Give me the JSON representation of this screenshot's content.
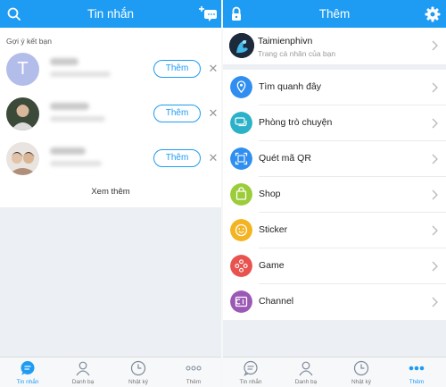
{
  "colors": {
    "accent": "#1e9cf3",
    "avatar_letter_bg": "#b3bde9"
  },
  "left": {
    "header": {
      "title": "Tin nhắn"
    },
    "suggestions": {
      "title": "Gợi ý kết bạn",
      "add_label": "Thêm",
      "see_more": "Xem thêm",
      "contacts": [
        {
          "avatar_letter": "T"
        },
        {
          "avatar_letter": ""
        },
        {
          "avatar_letter": ""
        }
      ]
    },
    "tabs": [
      {
        "label": "Tin nhắn",
        "icon": "chat-bubble-icon",
        "active": true
      },
      {
        "label": "Danh bạ",
        "icon": "contacts-icon",
        "active": false
      },
      {
        "label": "Nhật ký",
        "icon": "clock-icon",
        "active": false
      },
      {
        "label": "Thêm",
        "icon": "more-dots-icon",
        "active": false
      }
    ]
  },
  "right": {
    "header": {
      "title": "Thêm"
    },
    "profile": {
      "name": "Taimienphivn",
      "subtitle": "Trang cá nhân của bạn"
    },
    "menu": [
      {
        "label": "Tìm quanh đây",
        "icon": "location-pin-icon",
        "color": "#2f8ef0"
      },
      {
        "label": "Phòng trò chuyện",
        "icon": "chat-room-icon",
        "color": "#2bb1c8"
      },
      {
        "label": "Quét mã QR",
        "icon": "qr-scan-icon",
        "color": "#2f8ef0"
      },
      {
        "label": "Shop",
        "icon": "shop-bag-icon",
        "color": "#9ccc3a"
      },
      {
        "label": "Sticker",
        "icon": "sticker-smile-icon",
        "color": "#f4b320"
      },
      {
        "label": "Game",
        "icon": "gamepad-icon",
        "color": "#e8534f"
      },
      {
        "label": "Channel",
        "icon": "channel-icon",
        "color": "#9b59b6"
      }
    ],
    "tabs": [
      {
        "label": "Tin nhắn",
        "icon": "chat-bubble-icon",
        "active": false
      },
      {
        "label": "Danh bạ",
        "icon": "contacts-icon",
        "active": false
      },
      {
        "label": "Nhật ký",
        "icon": "clock-icon",
        "active": false
      },
      {
        "label": "Thêm",
        "icon": "more-dots-icon",
        "active": true
      }
    ]
  }
}
